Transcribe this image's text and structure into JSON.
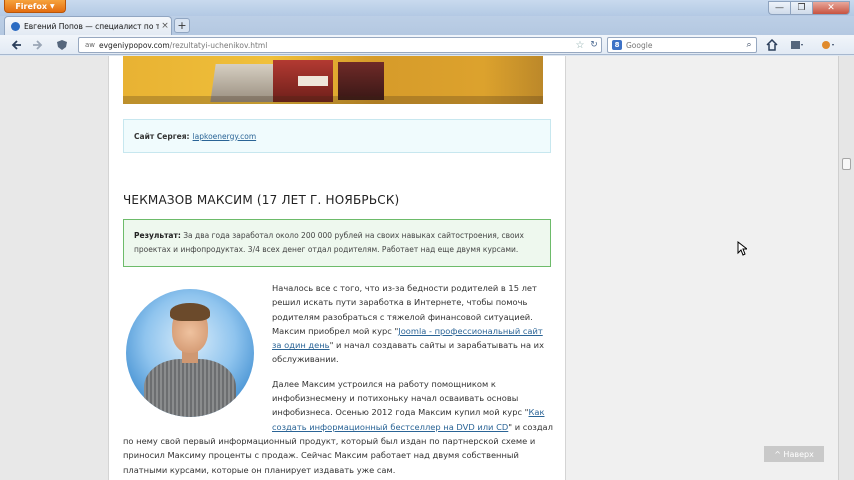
{
  "browser": {
    "menu_button": "Firefox",
    "tab": {
      "title": "Евгений Попов — специалист по техн...",
      "close": "×"
    },
    "new_tab": "+",
    "window_controls": {
      "minimize": "—",
      "restore": "❐",
      "close": "✕"
    },
    "url": {
      "domain": "evgeniypopov.com",
      "path": "/rezultatyi-uchenikov.html",
      "site_tag": "aw"
    },
    "search": {
      "placeholder": "Google",
      "engine_letter": "8"
    }
  },
  "page": {
    "site_box": {
      "label": "Сайт Сергея:",
      "link": "lapkoenergy.com"
    },
    "heading": "ЧЕКМАЗОВ МАКСИМ (17 ЛЕТ Г. НОЯБРЬСК)",
    "result": {
      "label": "Результат:",
      "text": "За два года заработал около 200 000 рублей на своих навыках сайтостроения, своих проектах и инфопродуктах. 3/4 всех денег отдал родителям. Работает над еще двумя курсами."
    },
    "paragraph1": {
      "part1": "Началось все с того, что из-за бедности родителей в 15 лет решил искать пути заработка в Интернете, чтобы помочь родителям разобраться с тяжелой финансовой ситуацией. Максим приобрел мой курс \"",
      "link": "Joomla - профессиональный сайт за один день",
      "part2": "\" и начал создавать сайты и зарабатывать на их обслуживании."
    },
    "paragraph2": {
      "part1": "Далее Максим устроился на работу помощником к инфобизнесмену и потихоньку начал осваивать основы инфобизнеса. Осенью 2012 года Максим купил мой курс \"",
      "link": "Как создать информационный бестселлер на DVD или CD",
      "part2": "\" и создал по нему свой первый информационный продукт, который был издан по партнерской схеме и приносил Максиму проценты с продаж. Сейчас Максим работает над двумя собственный платными курсами, которые он планирует издавать уже сам."
    },
    "scroll_up_button": "^ Наверх"
  }
}
